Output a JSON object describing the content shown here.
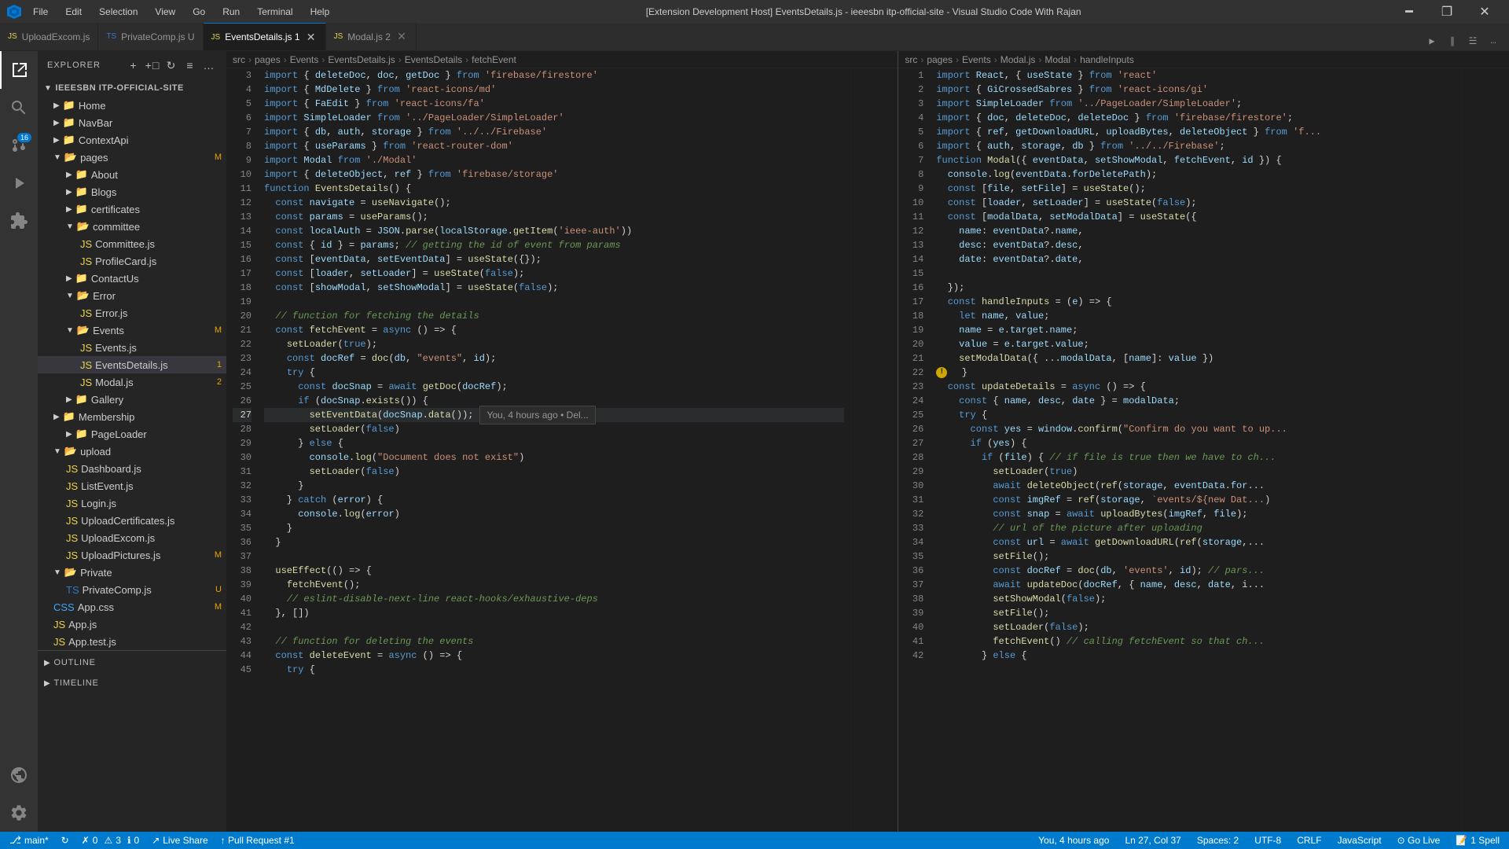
{
  "titlebar": {
    "title": "[Extension Development Host] EventsDetails.js - ieeesbn itp-official-site - Visual Studio Code With Rajan",
    "menu_items": [
      "File",
      "Edit",
      "Selection",
      "View",
      "Go",
      "Run",
      "Terminal",
      "Help"
    ]
  },
  "tabs": {
    "left_tabs": [
      {
        "id": "upload",
        "label": "UploadExcom.js",
        "icon": "js",
        "active": false,
        "modified": false,
        "closable": false
      },
      {
        "id": "private",
        "label": "PrivateComp.js U",
        "icon": "ts",
        "active": false,
        "modified": true,
        "closable": false
      },
      {
        "id": "eventsdetails",
        "label": "EventsDetails.js",
        "icon": "js",
        "active": true,
        "modified": true,
        "closable": true,
        "badge": "1"
      },
      {
        "id": "modal",
        "label": "Modal.js",
        "icon": "js",
        "active": false,
        "modified": true,
        "closable": true,
        "badge": "2"
      }
    ]
  },
  "sidebar": {
    "title": "EXPLORER",
    "root": "IEEESBN ITP-OFFICIAL-SITE",
    "items": [
      {
        "label": "Home",
        "type": "folder",
        "depth": 1,
        "expanded": false
      },
      {
        "label": "NavBar",
        "type": "folder",
        "depth": 1,
        "expanded": false
      },
      {
        "label": "ContextApi",
        "type": "folder",
        "depth": 1,
        "expanded": false
      },
      {
        "label": "pages",
        "type": "folder",
        "depth": 1,
        "expanded": true,
        "modified": true
      },
      {
        "label": "About",
        "type": "folder",
        "depth": 2,
        "expanded": false
      },
      {
        "label": "Blogs",
        "type": "folder",
        "depth": 2,
        "expanded": false
      },
      {
        "label": "certificates",
        "type": "folder",
        "depth": 2,
        "expanded": false
      },
      {
        "label": "committee",
        "type": "folder",
        "depth": 2,
        "expanded": true
      },
      {
        "label": "Committee.js",
        "type": "js",
        "depth": 3
      },
      {
        "label": "ProfileCard.js",
        "type": "js",
        "depth": 3
      },
      {
        "label": "ContactUs",
        "type": "folder",
        "depth": 2,
        "expanded": false
      },
      {
        "label": "Error",
        "type": "folder",
        "depth": 2,
        "expanded": true
      },
      {
        "label": "Error.js",
        "type": "js",
        "depth": 3
      },
      {
        "label": "Events",
        "type": "folder",
        "depth": 2,
        "expanded": true,
        "modified": true
      },
      {
        "label": "Events.js",
        "type": "js",
        "depth": 3
      },
      {
        "label": "EventsDetails.js",
        "type": "js",
        "depth": 3,
        "active": true,
        "badge": "1"
      },
      {
        "label": "Modal.js",
        "type": "js",
        "depth": 3,
        "badge": "2"
      },
      {
        "label": "Gallery",
        "type": "folder",
        "depth": 2,
        "expanded": false
      },
      {
        "label": "Membership",
        "type": "folder",
        "depth": 1,
        "expanded": false
      },
      {
        "label": "PageLoader",
        "type": "folder",
        "depth": 2,
        "expanded": false
      },
      {
        "label": "upload",
        "type": "folder",
        "depth": 1,
        "expanded": true
      },
      {
        "label": "Dashboard.js",
        "type": "js",
        "depth": 2
      },
      {
        "label": "ListEvent.js",
        "type": "js",
        "depth": 2
      },
      {
        "label": "Login.js",
        "type": "js",
        "depth": 2
      },
      {
        "label": "UploadCertificates.js",
        "type": "js",
        "depth": 2
      },
      {
        "label": "UploadExcom.js",
        "type": "js",
        "depth": 2
      },
      {
        "label": "UploadPictures.js",
        "type": "js",
        "depth": 2,
        "modified": "M"
      },
      {
        "label": "Private",
        "type": "folder",
        "depth": 1,
        "expanded": true
      },
      {
        "label": "PrivateComp.js",
        "type": "ts",
        "depth": 2,
        "modified": "U"
      },
      {
        "label": "App.css",
        "type": "css",
        "depth": 1,
        "modified": "M"
      },
      {
        "label": "App.js",
        "type": "js",
        "depth": 1
      },
      {
        "label": "App.test.js",
        "type": "js",
        "depth": 1
      }
    ]
  },
  "breadcrumb_left": {
    "parts": [
      "src",
      ">",
      "pages",
      ">",
      "Events",
      ">",
      "EventsDetails.js",
      ">",
      "EventsDetails",
      ">",
      "fetchEvent"
    ]
  },
  "breadcrumb_right": {
    "parts": [
      "src",
      ">",
      "pages",
      ">",
      "Events",
      ">",
      "Modal.js",
      ">",
      "Modal",
      ">",
      "handleInputs"
    ]
  },
  "code_left": [
    {
      "num": 3,
      "text": "import { deleteDoc, doc, getDoc } from 'firebase/firestore'"
    },
    {
      "num": 4,
      "text": "import { MdDelete } from 'react-icons/md'"
    },
    {
      "num": 5,
      "text": "import { FaEdit } from 'react-icons/fa'"
    },
    {
      "num": 6,
      "text": "import SimpleLoader from '../PageLoader/SimpleLoader'"
    },
    {
      "num": 7,
      "text": "import { db, auth, storage } from '../../Firebase'"
    },
    {
      "num": 8,
      "text": "import { useParams } from 'react-router-dom'"
    },
    {
      "num": 9,
      "text": "import Modal from './Modal'"
    },
    {
      "num": 10,
      "text": "import { deleteObject, ref } from 'firebase/storage'"
    },
    {
      "num": 11,
      "text": "function EventsDetails() {"
    },
    {
      "num": 12,
      "text": "  const navigate = useNavigate();"
    },
    {
      "num": 13,
      "text": "  const params = useParams();"
    },
    {
      "num": 14,
      "text": "  const localAuth = JSON.parse(localStorage.getItem('ieee-auth'))"
    },
    {
      "num": 15,
      "text": "  const { id } = params; // getting the id of event from params"
    },
    {
      "num": 16,
      "text": "  const [eventData, setEventData] = useState({});"
    },
    {
      "num": 17,
      "text": "  const [loader, setLoader] = useState(false);"
    },
    {
      "num": 18,
      "text": "  const [showModal, setShowModal] = useState(false);"
    },
    {
      "num": 19,
      "text": ""
    },
    {
      "num": 20,
      "text": "  // function for fetching the details"
    },
    {
      "num": 21,
      "text": "  const fetchEvent = async () => {"
    },
    {
      "num": 22,
      "text": "    setLoader(true);"
    },
    {
      "num": 23,
      "text": "    const docRef = doc(db, \"events\", id);"
    },
    {
      "num": 24,
      "text": "    try {"
    },
    {
      "num": 25,
      "text": "      const docSnap = await getDoc(docRef);"
    },
    {
      "num": 26,
      "text": "      if (docSnap.exists()) {"
    },
    {
      "num": 27,
      "text": "        setEventData(docSnap.data());",
      "hint": "You, 4 hours ago • Del..."
    },
    {
      "num": 28,
      "text": "        setLoader(false)"
    },
    {
      "num": 29,
      "text": "      } else {"
    },
    {
      "num": 30,
      "text": "        console.log(\"Document does not exist\")"
    },
    {
      "num": 31,
      "text": "        setLoader(false)"
    },
    {
      "num": 32,
      "text": "      }"
    },
    {
      "num": 33,
      "text": "    } catch (error) {"
    },
    {
      "num": 34,
      "text": "      console.log(error)"
    },
    {
      "num": 35,
      "text": "    }"
    },
    {
      "num": 36,
      "text": "  }"
    },
    {
      "num": 37,
      "text": ""
    },
    {
      "num": 38,
      "text": "  useEffect(() => {"
    },
    {
      "num": 39,
      "text": "    fetchEvent();"
    },
    {
      "num": 40,
      "text": "    // eslint-disable-next-line react-hooks/exhaustive-deps"
    },
    {
      "num": 41,
      "text": "  }, [])"
    },
    {
      "num": 42,
      "text": ""
    },
    {
      "num": 43,
      "text": "  // function for deleting the events"
    },
    {
      "num": 44,
      "text": "  const deleteEvent = async () => {"
    },
    {
      "num": 45,
      "text": "    try {"
    }
  ],
  "code_right": [
    {
      "num": 1,
      "text": "import React, { useState } from 'react'"
    },
    {
      "num": 2,
      "text": "import { GiCrossedSabres } from 'react-icons/gi'"
    },
    {
      "num": 3,
      "text": "import SimpleLoader from '../PageLoader/SimpleLoader';"
    },
    {
      "num": 4,
      "text": "import { doc, deleteDoc, deleteDoc } from 'firebase/firestore';"
    },
    {
      "num": 5,
      "text": "import { ref, getDownloadURL, uploadBytes, deleteObject } from 'f..."
    },
    {
      "num": 6,
      "text": "import { auth, storage, db } from '../../Firebase';"
    },
    {
      "num": 7,
      "text": "function Modal({ eventData, setShowModal, fetchEvent, id }) {"
    },
    {
      "num": 8,
      "text": "  console.log(eventData.forDeletePath);"
    },
    {
      "num": 9,
      "text": "  const [file, setFile] = useState();"
    },
    {
      "num": 10,
      "text": "  const [loader, setLoader] = useState(false);"
    },
    {
      "num": 11,
      "text": "  const [modalData, setModalData] = useState({"
    },
    {
      "num": 12,
      "text": "    name: eventData?.name,"
    },
    {
      "num": 13,
      "text": "    desc: eventData?.desc,"
    },
    {
      "num": 14,
      "text": "    date: eventData?.date,"
    },
    {
      "num": 15,
      "text": ""
    },
    {
      "num": 16,
      "text": "  });"
    },
    {
      "num": 17,
      "text": "  const handleInputs = (e) => {"
    },
    {
      "num": 18,
      "text": "    let name, value;"
    },
    {
      "num": 19,
      "text": "    name = e.target.name;"
    },
    {
      "num": 20,
      "text": "    value = e.target.value;"
    },
    {
      "num": 21,
      "text": "    setModalData({ ...modalData, [name]: value })"
    },
    {
      "num": 22,
      "text": "  }",
      "warning": true
    },
    {
      "num": 23,
      "text": "  const updateDetails = async () => {"
    },
    {
      "num": 24,
      "text": "    const { name, desc, date } = modalData;"
    },
    {
      "num": 25,
      "text": "    try {"
    },
    {
      "num": 26,
      "text": "      const yes = window.confirm(\"Confirm do you want to up..."
    },
    {
      "num": 27,
      "text": "      if (yes) {"
    },
    {
      "num": 28,
      "text": "        if (file) { // if file is true then we have to ch..."
    },
    {
      "num": 29,
      "text": "          setLoader(true)"
    },
    {
      "num": 30,
      "text": "          await deleteObject(ref(storage, eventData.for..."
    },
    {
      "num": 31,
      "text": "          const imgRef = ref(storage, `events/${new Dat..."
    },
    {
      "num": 32,
      "text": "          const snap = await uploadBytes(imgRef, file);"
    },
    {
      "num": 33,
      "text": "          // url of the picture after uploading"
    },
    {
      "num": 34,
      "text": "          const url = await getDownloadURL(ref(storage,..."
    },
    {
      "num": 35,
      "text": "          setFile();"
    },
    {
      "num": 36,
      "text": "          const docRef = doc(db, 'events', id); // pars..."
    },
    {
      "num": 37,
      "text": "          await updateDoc(docRef, { name, desc, date, i..."
    },
    {
      "num": 38,
      "text": "          setShowModal(false);"
    },
    {
      "num": 39,
      "text": "          setFile();"
    },
    {
      "num": 40,
      "text": "          setLoader(false);"
    },
    {
      "num": 41,
      "text": "          fetchEvent() // calling fetchEvent so that ch..."
    },
    {
      "num": 42,
      "text": "        } else {"
    }
  ],
  "outline_section": {
    "label": "OUTLINE"
  },
  "timeline_section": {
    "label": "TIMELINE"
  },
  "status_bar": {
    "branch": "main*",
    "sync_icon": "↻",
    "errors": "0",
    "warnings": "3",
    "info": "0",
    "live_share": "Live Share",
    "pull_request": "↑ Pull Request #1",
    "cursor": "Ln 27, Col 37",
    "spaces": "Spaces: 2",
    "encoding": "UTF-8",
    "line_ending": "CRLF",
    "language": "JavaScript",
    "go_live": "⊙ Go Live",
    "git_hint": "You, 4 hours ago",
    "spell": "1 Spell"
  }
}
